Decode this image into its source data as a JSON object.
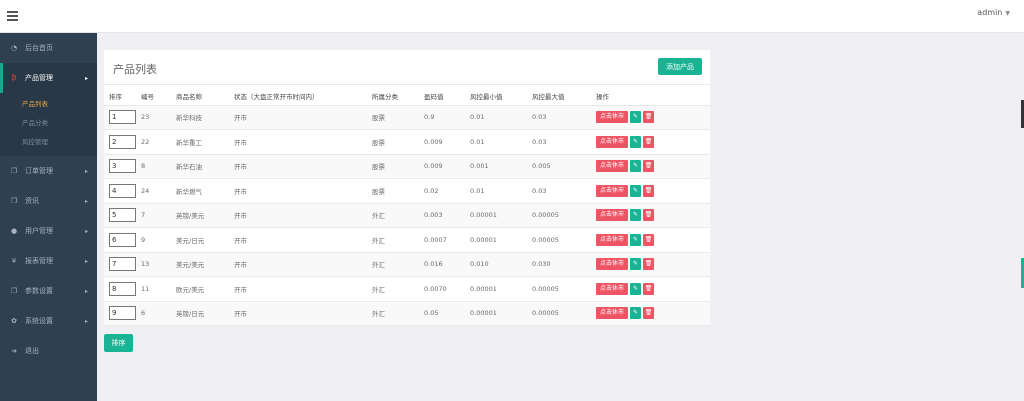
{
  "header": {
    "user": "admin"
  },
  "sidebar": {
    "items": [
      {
        "label": "后台首页",
        "icon": "dashboard-icon",
        "glyph": "◔"
      },
      {
        "label": "产品管理",
        "icon": "bitcoin-icon",
        "glyph": "₿"
      },
      {
        "label": "订单管理",
        "icon": "copy-icon",
        "glyph": "❐"
      },
      {
        "label": "资讯",
        "icon": "copy-icon",
        "glyph": "❐"
      },
      {
        "label": "用户管理",
        "icon": "user-icon",
        "glyph": "●"
      },
      {
        "label": "报表管理",
        "icon": "yen-icon",
        "glyph": "¥"
      },
      {
        "label": "参数设置",
        "icon": "copy-icon",
        "glyph": "❐"
      },
      {
        "label": "系统设置",
        "icon": "cogs-icon",
        "glyph": "✿"
      },
      {
        "label": "退出",
        "icon": "sign-out-icon",
        "glyph": "➜"
      }
    ],
    "subitems": [
      "产品列表",
      "产品分类",
      "风控管理"
    ]
  },
  "panel": {
    "title": "产品列表",
    "add_label": "添加产品"
  },
  "table": {
    "headers": [
      "排序",
      "编号",
      "商品名称",
      "状态（大盘正常开市时间内）",
      "所属分类",
      "盈码值",
      "风控最小值",
      "风控最大值",
      "操作"
    ],
    "rows": [
      {
        "sort": "1",
        "id": "23",
        "name": "新华科技",
        "status": "开市",
        "category": "股票",
        "point": "0.9",
        "min": "0.01",
        "max": "0.03"
      },
      {
        "sort": "2",
        "id": "22",
        "name": "新华重工",
        "status": "开市",
        "category": "股票",
        "point": "0.009",
        "min": "0.01",
        "max": "0.03"
      },
      {
        "sort": "3",
        "id": "8",
        "name": "新华石油",
        "status": "开市",
        "category": "股票",
        "point": "0.009",
        "min": "0.001",
        "max": "0.005"
      },
      {
        "sort": "4",
        "id": "24",
        "name": "新华燃气",
        "status": "开市",
        "category": "股票",
        "point": "0.02",
        "min": "0.01",
        "max": "0.03"
      },
      {
        "sort": "5",
        "id": "7",
        "name": "英镑/美元",
        "status": "开市",
        "category": "外汇",
        "point": "0.003",
        "min": "0.00001",
        "max": "0.00005"
      },
      {
        "sort": "6",
        "id": "9",
        "name": "美元/日元",
        "status": "开市",
        "category": "外汇",
        "point": "0.0007",
        "min": "0.00001",
        "max": "0.00005"
      },
      {
        "sort": "7",
        "id": "13",
        "name": "美元/美元",
        "status": "开市",
        "category": "外汇",
        "point": "0.016",
        "min": "0.010",
        "max": "0.030"
      },
      {
        "sort": "8",
        "id": "11",
        "name": "欧元/美元",
        "status": "开市",
        "category": "外汇",
        "point": "0.0070",
        "min": "0.00001",
        "max": "0.00005"
      },
      {
        "sort": "9",
        "id": "6",
        "name": "英镑/日元",
        "status": "开市",
        "category": "外汇",
        "point": "0.05",
        "min": "0.00001",
        "max": "0.00005"
      }
    ],
    "action_close": "点击休市",
    "edit_glyph": "✎",
    "delete_glyph": "🗑"
  },
  "footer": {
    "sort_label": "排序"
  },
  "colors": {
    "sidebar": "#2f4050",
    "accent": "#1ab394",
    "danger": "#ed5565"
  }
}
